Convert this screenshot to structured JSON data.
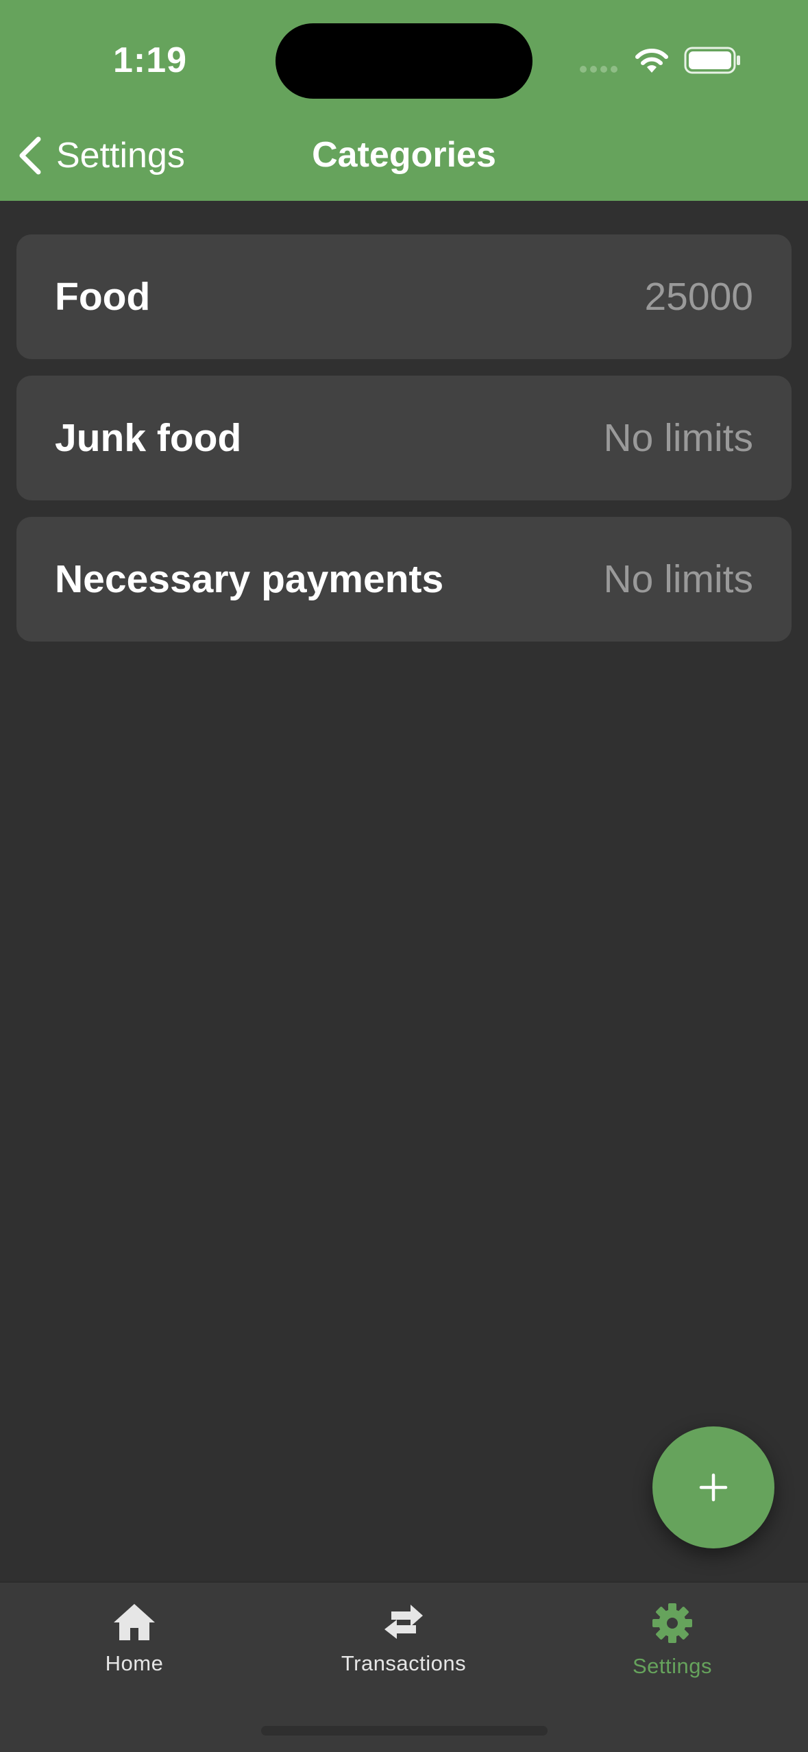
{
  "status_bar": {
    "time": "1:19"
  },
  "nav": {
    "back_label": "Settings",
    "title": "Categories"
  },
  "categories": [
    {
      "name": "Food",
      "limit": "25000"
    },
    {
      "name": "Junk food",
      "limit": "No limits"
    },
    {
      "name": "Necessary payments",
      "limit": "No limits"
    }
  ],
  "fab": {
    "icon": "plus-icon"
  },
  "tabs": [
    {
      "label": "Home",
      "icon": "home-icon",
      "active": false
    },
    {
      "label": "Transactions",
      "icon": "transfer-icon",
      "active": false
    },
    {
      "label": "Settings",
      "icon": "gear-icon",
      "active": true
    }
  ],
  "colors": {
    "accent": "#66a35c",
    "background": "#303030",
    "card": "#424242",
    "muted_text": "#9a9a9a",
    "inactive_tab": "#e6e6e6"
  }
}
